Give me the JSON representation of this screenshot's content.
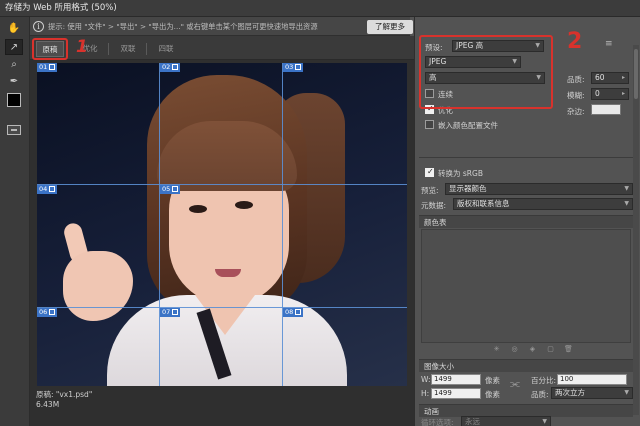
{
  "window": {
    "title": "存储为 Web 所用格式 (50%)"
  },
  "tools": [
    {
      "name": "hand-icon",
      "glyph": "✋"
    },
    {
      "name": "slice-select-icon",
      "glyph": "↗"
    },
    {
      "name": "zoom-icon",
      "glyph": "🔍"
    },
    {
      "name": "eyedropper-icon",
      "glyph": "✒"
    }
  ],
  "tip": {
    "icon": "i",
    "text": "提示: 使用 \"文件\" > \"导出\" > \"导出为...\" 或右键单击某个图层可更快速地导出资源",
    "learn_more": "了解更多"
  },
  "tabs": [
    "原稿",
    "优化",
    "双联",
    "四联"
  ],
  "slices": [
    "01",
    "02",
    "03",
    "04",
    "05",
    "06",
    "07",
    "08"
  ],
  "canvas_info": {
    "filename": "原稿: \"vx1.psd\"",
    "size": "6.43M"
  },
  "annotations": {
    "one": "1",
    "two": "2"
  },
  "settings": {
    "preset_label": "预设:",
    "preset_value": "JPEG 高",
    "format": "JPEG",
    "quality_level": "高",
    "quality_label": "品质:",
    "quality_value": "60",
    "progressive_label": "连续",
    "blur_label": "模糊:",
    "blur_value": "0",
    "optimized_label": "优化",
    "matte_label": "杂边:",
    "embed_profile_label": "嵌入颜色配置文件",
    "convert_srgb_label": "转换为 sRGB",
    "preview_label": "预览:",
    "preview_value": "显示器颜色",
    "metadata_label": "元数据:",
    "metadata_value": "版权和联系信息",
    "color_table_label": "颜色表",
    "image_size_label": "图像大小",
    "w_label": "W:",
    "w_value": "1499",
    "h_label": "H:",
    "h_value": "1499",
    "px_unit": "像素",
    "percent_label": "百分比:",
    "percent_value": "100",
    "quality2_label": "品质:",
    "quality2_value": "两次立方",
    "animation_label": "动画",
    "loop_label": "循环选项:",
    "loop_value": "永远"
  },
  "colors": {
    "accent": "#d8322c",
    "slice_blue": "#3b73c6"
  }
}
